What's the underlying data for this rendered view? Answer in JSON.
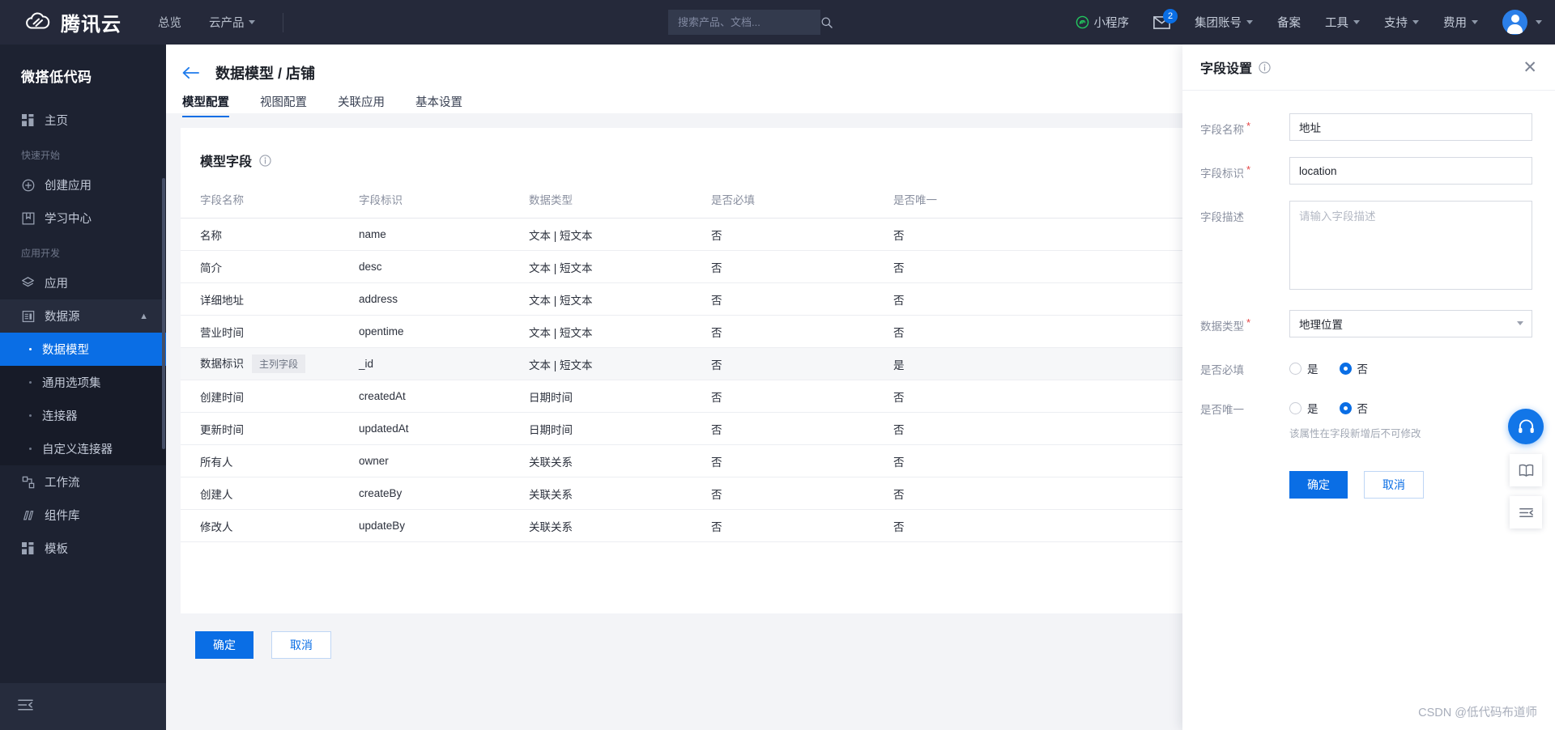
{
  "topbar": {
    "brand": "腾讯云",
    "nav": [
      {
        "label": "总览",
        "caret": false
      },
      {
        "label": "云产品",
        "caret": true
      }
    ],
    "search": {
      "placeholder": "搜索产品、文档...",
      "value": "",
      "icon": "search-icon"
    },
    "right": [
      {
        "label": "小程序",
        "icon": "miniprogram-icon",
        "caret": false
      },
      {
        "label": "",
        "icon": "mail-icon",
        "badge": "2",
        "caret": false
      },
      {
        "label": "集团账号",
        "caret": true
      },
      {
        "label": "备案",
        "caret": false
      },
      {
        "label": "工具",
        "caret": true
      },
      {
        "label": "支持",
        "caret": true
      },
      {
        "label": "费用",
        "caret": true
      }
    ],
    "avatar_caret": true
  },
  "sidebar": {
    "title": "微搭低代码",
    "home": {
      "label": "主页",
      "icon": "grid-icon"
    },
    "groups": [
      {
        "label": "快速开始",
        "items": [
          {
            "label": "创建应用",
            "icon": "plus-circle-icon"
          },
          {
            "label": "学习中心",
            "icon": "book-icon"
          }
        ]
      },
      {
        "label": "应用开发",
        "items": [
          {
            "label": "应用",
            "icon": "layers-icon"
          },
          {
            "label": "数据源",
            "icon": "database-icon",
            "expanded": true,
            "children": [
              {
                "label": "数据模型",
                "active": true
              },
              {
                "label": "通用选项集",
                "active": false
              },
              {
                "label": "连接器",
                "active": false
              },
              {
                "label": "自定义连接器",
                "active": false
              }
            ]
          },
          {
            "label": "工作流",
            "icon": "workflow-icon"
          },
          {
            "label": "组件库",
            "icon": "components-icon"
          },
          {
            "label": "模板",
            "icon": "template-icon"
          }
        ]
      }
    ],
    "collapse_icon": "collapse-icon"
  },
  "page": {
    "back_icon": "back-arrow-icon",
    "breadcrumb": "数据模型 / 店铺",
    "tabs": [
      {
        "label": "模型配置",
        "active": true
      },
      {
        "label": "视图配置",
        "active": false
      },
      {
        "label": "关联应用",
        "active": false
      },
      {
        "label": "基本设置",
        "active": false
      }
    ]
  },
  "card": {
    "title": "模型字段",
    "title_icon": "info-circle-icon",
    "columns": [
      "字段名称",
      "字段标识",
      "数据类型",
      "是否必填",
      "是否唯一"
    ],
    "rows": [
      {
        "name": "名称",
        "badge": "",
        "key": "name",
        "type": "文本 | 短文本",
        "required": "否",
        "unique": "否",
        "highlight": false
      },
      {
        "name": "简介",
        "badge": "",
        "key": "desc",
        "type": "文本 | 短文本",
        "required": "否",
        "unique": "否",
        "highlight": false
      },
      {
        "name": "详细地址",
        "badge": "",
        "key": "address",
        "type": "文本 | 短文本",
        "required": "否",
        "unique": "否",
        "highlight": false
      },
      {
        "name": "营业时间",
        "badge": "",
        "key": "opentime",
        "type": "文本 | 短文本",
        "required": "否",
        "unique": "否",
        "highlight": false
      },
      {
        "name": "数据标识",
        "badge": "主列字段",
        "key": "_id",
        "type": "文本 | 短文本",
        "required": "否",
        "unique": "是",
        "highlight": true
      },
      {
        "name": "创建时间",
        "badge": "",
        "key": "createdAt",
        "type": "日期时间",
        "required": "否",
        "unique": "否",
        "highlight": false
      },
      {
        "name": "更新时间",
        "badge": "",
        "key": "updatedAt",
        "type": "日期时间",
        "required": "否",
        "unique": "否",
        "highlight": false
      },
      {
        "name": "所有人",
        "badge": "",
        "key": "owner",
        "type": "关联关系",
        "required": "否",
        "unique": "否",
        "highlight": false
      },
      {
        "name": "创建人",
        "badge": "",
        "key": "createBy",
        "type": "关联关系",
        "required": "否",
        "unique": "否",
        "highlight": false
      },
      {
        "name": "修改人",
        "badge": "",
        "key": "updateBy",
        "type": "关联关系",
        "required": "否",
        "unique": "否",
        "highlight": false
      }
    ]
  },
  "footer": {
    "confirm": "确定",
    "cancel": "取消"
  },
  "panel": {
    "title": "字段设置",
    "title_icon": "info-circle-icon",
    "close_icon": "close-icon",
    "field_name": {
      "label": "字段名称",
      "required": true,
      "value": "地址"
    },
    "field_key": {
      "label": "字段标识",
      "required": true,
      "value": "location"
    },
    "field_desc": {
      "label": "字段描述",
      "required": false,
      "value": "",
      "placeholder": "请输入字段描述"
    },
    "data_type": {
      "label": "数据类型",
      "required": true,
      "value": "地理位置",
      "caret_icon": "chevron-down-icon"
    },
    "is_required": {
      "label": "是否必填",
      "options": [
        "是",
        "否"
      ],
      "selected": "否"
    },
    "is_unique": {
      "label": "是否唯一",
      "options": [
        "是",
        "否"
      ],
      "selected": "否"
    },
    "unique_hint": "该属性在字段新增后不可修改",
    "confirm": "确定",
    "cancel": "取消"
  },
  "floats": [
    {
      "icon": "headset-icon",
      "style": "blue"
    },
    {
      "icon": "book-open-icon",
      "style": "white"
    },
    {
      "icon": "list-settings-icon",
      "style": "white"
    }
  ],
  "watermark": "CSDN @低代码布道师",
  "colors": {
    "accent": "#0a6ee5",
    "topbar_bg": "#25293a",
    "sidebar_bg": "#1d2231",
    "active_item": "#0a6ee5",
    "required_star": "#e54545"
  }
}
